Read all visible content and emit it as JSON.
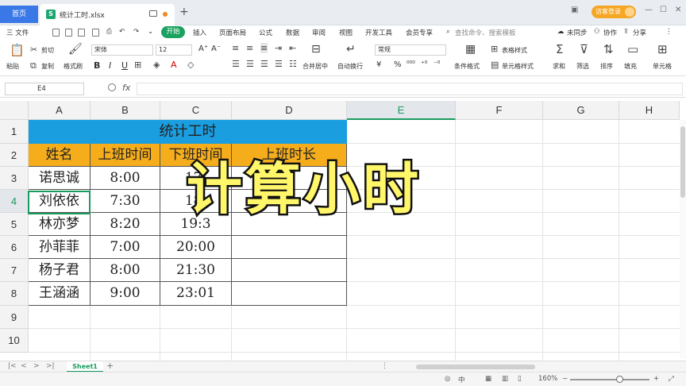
{
  "titlebar": {
    "home_tab": "首页",
    "file_name": "统计工时.xlsx",
    "new_tab": "+",
    "login": "访客登录",
    "controls": [
      "—",
      "☐",
      "✕"
    ]
  },
  "menubar": {
    "file": "三 文件",
    "start": "开始",
    "items": [
      "插入",
      "页面布局",
      "公式",
      "数据",
      "审阅",
      "视图",
      "开发工具",
      "会员专享"
    ],
    "search": "查找命令、搜索模板",
    "sync": "未同步",
    "collab": "协作",
    "share": "分享"
  },
  "ribbon": {
    "paste": "粘贴",
    "cut": "剪切",
    "copy": "复制",
    "format_painter": "格式刷",
    "font": "宋体",
    "font_size": "12",
    "bold": "B",
    "italic": "I",
    "underline": "U",
    "merge": "合并居中",
    "wrap": "自动换行",
    "number_format": "常规",
    "currency": "¥",
    "percent": "%",
    "cond_format": "条件格式",
    "table_style": "表格样式",
    "cell_style": "单元格样式",
    "sum": "求和",
    "filter": "筛选",
    "sort": "排序",
    "fill": "填充",
    "cell": "单元格"
  },
  "formula_bar": {
    "cell_ref": "E4",
    "fx": "fx",
    "value": ""
  },
  "grid": {
    "columns": [
      "A",
      "B",
      "C",
      "D",
      "E",
      "F",
      "G",
      "H"
    ],
    "rows": [
      "1",
      "2",
      "3",
      "4",
      "5",
      "6",
      "7",
      "8",
      "9",
      "10"
    ],
    "table_title": "统计工时",
    "headers": [
      "姓名",
      "上班时间",
      "下班时间",
      "上班时长"
    ],
    "data": [
      [
        "诺思诚",
        "8:00",
        "17:",
        ""
      ],
      [
        "刘依依",
        "7:30",
        "18:",
        ""
      ],
      [
        "林亦梦",
        "8:20",
        "19:3",
        ""
      ],
      [
        "孙菲菲",
        "7:00",
        "20:00",
        ""
      ],
      [
        "杨子君",
        "8:00",
        "21:30",
        ""
      ],
      [
        "王涵涵",
        "9:00",
        "23:01",
        ""
      ]
    ]
  },
  "overlay": {
    "text": "计算小时"
  },
  "sheets": {
    "active": "Sheet1",
    "add": "+"
  },
  "status": {
    "zoom": "160%"
  },
  "colors": {
    "title_fill": "#1a9ee0",
    "header_fill": "#f5ad1c",
    "accent_green": "#1a9c5f",
    "overlay_fill": "#fff66a"
  }
}
